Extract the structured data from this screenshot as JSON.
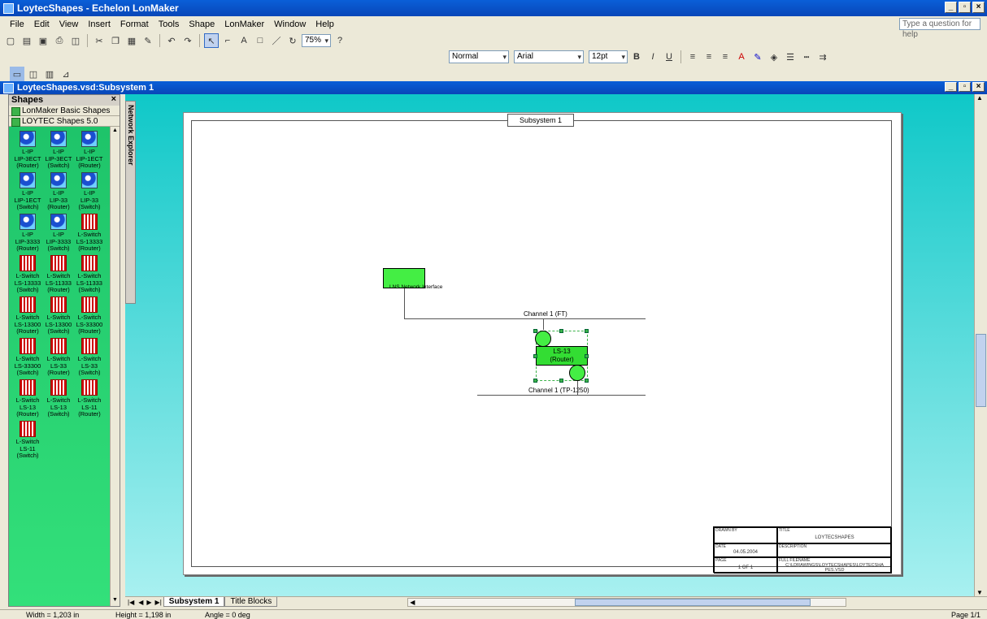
{
  "window": {
    "title": "LoytecShapes - Echelon LonMaker",
    "doc_title": "LoytecShapes.vsd:Subsystem 1"
  },
  "menu": {
    "items": [
      "File",
      "Edit",
      "View",
      "Insert",
      "Format",
      "Tools",
      "Shape",
      "LonMaker",
      "Window",
      "Help"
    ],
    "ask_placeholder": "Type a question for help"
  },
  "toolbar": {
    "zoom": "75%",
    "style": "Normal",
    "font": "Arial",
    "size": "12pt"
  },
  "shapes_panel": {
    "title": "Shapes",
    "stencils": [
      "LonMaker Basic Shapes",
      "LOYTEC Shapes 5.0"
    ],
    "masters": [
      {
        "l1": "L-IP",
        "l2": "LIP-3ECT",
        "l3": "(Router)",
        "kind": "lip"
      },
      {
        "l1": "L-IP",
        "l2": "LIP-3ECT",
        "l3": "(Switch)",
        "kind": "lip"
      },
      {
        "l1": "L-IP",
        "l2": "LIP-1ECT",
        "l3": "(Router)",
        "kind": "lip"
      },
      {
        "l1": "L-IP",
        "l2": "LIP-1ECT",
        "l3": "(Switch)",
        "kind": "lip"
      },
      {
        "l1": "L-IP",
        "l2": "LIP-33",
        "l3": "(Router)",
        "kind": "lip"
      },
      {
        "l1": "L-IP",
        "l2": "LIP-33",
        "l3": "(Switch)",
        "kind": "lip"
      },
      {
        "l1": "L-IP",
        "l2": "LIP-3333",
        "l3": "(Router)",
        "kind": "lip"
      },
      {
        "l1": "L-IP",
        "l2": "LIP-3333",
        "l3": "(Switch)",
        "kind": "lip"
      },
      {
        "l1": "L-Switch",
        "l2": "LS-13333",
        "l3": "(Router)",
        "kind": "ls"
      },
      {
        "l1": "L-Switch",
        "l2": "LS-13333",
        "l3": "(Switch)",
        "kind": "ls"
      },
      {
        "l1": "L-Switch",
        "l2": "LS-11333",
        "l3": "(Router)",
        "kind": "ls"
      },
      {
        "l1": "L-Switch",
        "l2": "LS-11333",
        "l3": "(Switch)",
        "kind": "ls"
      },
      {
        "l1": "L-Switch",
        "l2": "LS-13300",
        "l3": "(Router)",
        "kind": "ls"
      },
      {
        "l1": "L-Switch",
        "l2": "LS-13300",
        "l3": "(Switch)",
        "kind": "ls"
      },
      {
        "l1": "L-Switch",
        "l2": "LS-33300",
        "l3": "(Router)",
        "kind": "ls"
      },
      {
        "l1": "L-Switch",
        "l2": "LS-33300",
        "l3": "(Switch)",
        "kind": "ls"
      },
      {
        "l1": "L-Switch",
        "l2": "LS-33",
        "l3": "(Router)",
        "kind": "ls"
      },
      {
        "l1": "L-Switch",
        "l2": "LS-33",
        "l3": "(Switch)",
        "kind": "ls"
      },
      {
        "l1": "L-Switch",
        "l2": "LS-13",
        "l3": "(Router)",
        "kind": "ls"
      },
      {
        "l1": "L-Switch",
        "l2": "LS-13",
        "l3": "(Switch)",
        "kind": "ls"
      },
      {
        "l1": "L-Switch",
        "l2": "LS-11",
        "l3": "(Router)",
        "kind": "ls"
      },
      {
        "l1": "L-Switch",
        "l2": "LS-11",
        "l3": "(Switch)",
        "kind": "ls"
      }
    ]
  },
  "network_explorer": "Network Explorer",
  "drawing": {
    "subsystem_title": "Subsystem 1",
    "netif_label": "LNS Network Interface",
    "channel1": "Channel 1 (FT)",
    "channel2": "Channel 1 (TP-1250)",
    "router_l1": "LS-13",
    "router_l2": "(Router)",
    "title_block": {
      "drawn_by_hdr": "DRAWN BY",
      "title_hdr": "TITLE",
      "title": "LOYTECSHAPES",
      "date_hdr": "DATE",
      "date": "04.05.2004",
      "desc_hdr": "DESCRIPTION",
      "page_hdr": "PAGE",
      "page": "1 OF 1",
      "file_hdr": "FULL FILENAME",
      "file": "C:\\LDRAWINGS\\LOYTECSHAPES\\LOYTECSHAPES.VSD"
    }
  },
  "tabs": [
    "Subsystem 1",
    "Title Blocks"
  ],
  "status": {
    "width": "Width = 1,203 in",
    "height": "Height = 1,198 in",
    "angle": "Angle = 0 deg",
    "page": "Page 1/1"
  }
}
